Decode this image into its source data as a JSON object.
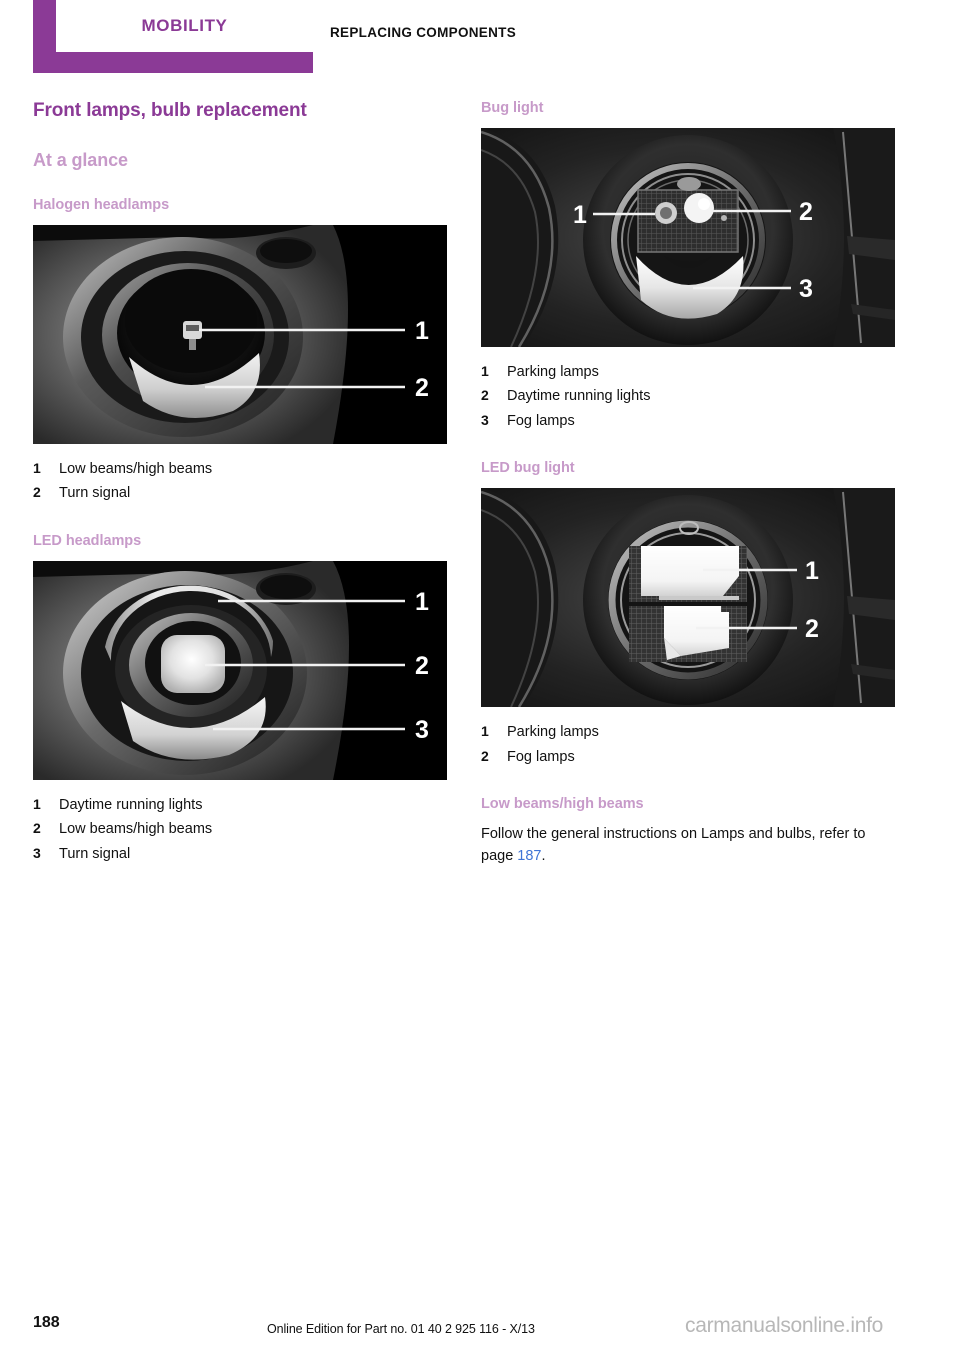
{
  "header": {
    "tab_label": "MOBILITY",
    "section_title": "REPLACING COMPONENTS",
    "tab_color": "#8b3a96"
  },
  "colors": {
    "heading_primary": "#8b3a96",
    "heading_secondary": "#c79ac9",
    "page_link": "#3f74d6",
    "watermark": "#b7b7b7"
  },
  "left_column": {
    "title": "Front lamps, bulb replacement",
    "subtitle": "At a glance",
    "sections": [
      {
        "heading": "Halogen headlamps",
        "figure_name": "halogen-headlamp-photo",
        "figure_alt": "Grayscale photo of halogen headlamp with callouts",
        "callouts": [
          {
            "num": "1",
            "label": "Low beams/high beams"
          },
          {
            "num": "2",
            "label": "Turn signal"
          }
        ]
      },
      {
        "heading": "LED headlamps",
        "figure_name": "led-headlamp-photo",
        "figure_alt": "Grayscale photo of LED headlamp with callouts",
        "callouts": [
          {
            "num": "1",
            "label": "Daytime running lights"
          },
          {
            "num": "2",
            "label": "Low beams/high beams"
          },
          {
            "num": "3",
            "label": "Turn signal"
          }
        ]
      }
    ]
  },
  "right_column": {
    "sections": [
      {
        "heading": "Bug light",
        "figure_name": "bug-light-photo",
        "figure_alt": "Grayscale photo of bug light assembly with callouts",
        "callouts": [
          {
            "num": "1",
            "label": "Parking lamps"
          },
          {
            "num": "2",
            "label": "Daytime running lights"
          },
          {
            "num": "3",
            "label": "Fog lamps"
          }
        ]
      },
      {
        "heading": "LED bug light",
        "figure_name": "led-bug-light-photo",
        "figure_alt": "Grayscale photo of LED bug light assembly with callouts",
        "callouts": [
          {
            "num": "1",
            "label": "Parking lamps"
          },
          {
            "num": "2",
            "label": "Fog lamps"
          }
        ]
      }
    ],
    "final_section": {
      "heading": "Low beams/high beams",
      "body_before": "Follow the general instructions on Lamps and bulbs, refer to page ",
      "page_ref": "187",
      "body_after": "."
    }
  },
  "footer": {
    "page_number": "188",
    "edition_text": "Online Edition for Part no. 01 40 2 925 116 - X/13",
    "watermark": "carmanualsonline.info"
  }
}
